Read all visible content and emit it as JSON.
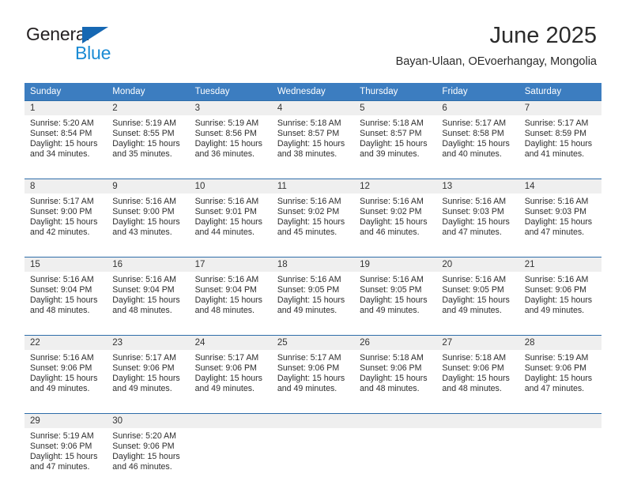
{
  "brand": {
    "name_part1": "General",
    "name_part2": "Blue",
    "logo_icon": "triangle-logo-icon",
    "color_dark": "#231F20",
    "color_blue": "#1A8BD4",
    "color_triangle": "#1668B3"
  },
  "header": {
    "title": "June 2025",
    "subtitle": "Bayan-Ulaan, OEvoerhangay, Mongolia"
  },
  "theme": {
    "header_row_bg": "#3C7DC0",
    "row_border": "#2E6DA9",
    "daynum_bg": "#EFEFEF",
    "text": "#2D2D2D"
  },
  "weekday_headers": [
    "Sunday",
    "Monday",
    "Tuesday",
    "Wednesday",
    "Thursday",
    "Friday",
    "Saturday"
  ],
  "weeks": [
    {
      "days": [
        {
          "num": "1",
          "sunrise": "Sunrise: 5:20 AM",
          "sunset": "Sunset: 8:54 PM",
          "daylight": "Daylight: 15 hours and 34 minutes."
        },
        {
          "num": "2",
          "sunrise": "Sunrise: 5:19 AM",
          "sunset": "Sunset: 8:55 PM",
          "daylight": "Daylight: 15 hours and 35 minutes."
        },
        {
          "num": "3",
          "sunrise": "Sunrise: 5:19 AM",
          "sunset": "Sunset: 8:56 PM",
          "daylight": "Daylight: 15 hours and 36 minutes."
        },
        {
          "num": "4",
          "sunrise": "Sunrise: 5:18 AM",
          "sunset": "Sunset: 8:57 PM",
          "daylight": "Daylight: 15 hours and 38 minutes."
        },
        {
          "num": "5",
          "sunrise": "Sunrise: 5:18 AM",
          "sunset": "Sunset: 8:57 PM",
          "daylight": "Daylight: 15 hours and 39 minutes."
        },
        {
          "num": "6",
          "sunrise": "Sunrise: 5:17 AM",
          "sunset": "Sunset: 8:58 PM",
          "daylight": "Daylight: 15 hours and 40 minutes."
        },
        {
          "num": "7",
          "sunrise": "Sunrise: 5:17 AM",
          "sunset": "Sunset: 8:59 PM",
          "daylight": "Daylight: 15 hours and 41 minutes."
        }
      ]
    },
    {
      "days": [
        {
          "num": "8",
          "sunrise": "Sunrise: 5:17 AM",
          "sunset": "Sunset: 9:00 PM",
          "daylight": "Daylight: 15 hours and 42 minutes."
        },
        {
          "num": "9",
          "sunrise": "Sunrise: 5:16 AM",
          "sunset": "Sunset: 9:00 PM",
          "daylight": "Daylight: 15 hours and 43 minutes."
        },
        {
          "num": "10",
          "sunrise": "Sunrise: 5:16 AM",
          "sunset": "Sunset: 9:01 PM",
          "daylight": "Daylight: 15 hours and 44 minutes."
        },
        {
          "num": "11",
          "sunrise": "Sunrise: 5:16 AM",
          "sunset": "Sunset: 9:02 PM",
          "daylight": "Daylight: 15 hours and 45 minutes."
        },
        {
          "num": "12",
          "sunrise": "Sunrise: 5:16 AM",
          "sunset": "Sunset: 9:02 PM",
          "daylight": "Daylight: 15 hours and 46 minutes."
        },
        {
          "num": "13",
          "sunrise": "Sunrise: 5:16 AM",
          "sunset": "Sunset: 9:03 PM",
          "daylight": "Daylight: 15 hours and 47 minutes."
        },
        {
          "num": "14",
          "sunrise": "Sunrise: 5:16 AM",
          "sunset": "Sunset: 9:03 PM",
          "daylight": "Daylight: 15 hours and 47 minutes."
        }
      ]
    },
    {
      "days": [
        {
          "num": "15",
          "sunrise": "Sunrise: 5:16 AM",
          "sunset": "Sunset: 9:04 PM",
          "daylight": "Daylight: 15 hours and 48 minutes."
        },
        {
          "num": "16",
          "sunrise": "Sunrise: 5:16 AM",
          "sunset": "Sunset: 9:04 PM",
          "daylight": "Daylight: 15 hours and 48 minutes."
        },
        {
          "num": "17",
          "sunrise": "Sunrise: 5:16 AM",
          "sunset": "Sunset: 9:04 PM",
          "daylight": "Daylight: 15 hours and 48 minutes."
        },
        {
          "num": "18",
          "sunrise": "Sunrise: 5:16 AM",
          "sunset": "Sunset: 9:05 PM",
          "daylight": "Daylight: 15 hours and 49 minutes."
        },
        {
          "num": "19",
          "sunrise": "Sunrise: 5:16 AM",
          "sunset": "Sunset: 9:05 PM",
          "daylight": "Daylight: 15 hours and 49 minutes."
        },
        {
          "num": "20",
          "sunrise": "Sunrise: 5:16 AM",
          "sunset": "Sunset: 9:05 PM",
          "daylight": "Daylight: 15 hours and 49 minutes."
        },
        {
          "num": "21",
          "sunrise": "Sunrise: 5:16 AM",
          "sunset": "Sunset: 9:06 PM",
          "daylight": "Daylight: 15 hours and 49 minutes."
        }
      ]
    },
    {
      "days": [
        {
          "num": "22",
          "sunrise": "Sunrise: 5:16 AM",
          "sunset": "Sunset: 9:06 PM",
          "daylight": "Daylight: 15 hours and 49 minutes."
        },
        {
          "num": "23",
          "sunrise": "Sunrise: 5:17 AM",
          "sunset": "Sunset: 9:06 PM",
          "daylight": "Daylight: 15 hours and 49 minutes."
        },
        {
          "num": "24",
          "sunrise": "Sunrise: 5:17 AM",
          "sunset": "Sunset: 9:06 PM",
          "daylight": "Daylight: 15 hours and 49 minutes."
        },
        {
          "num": "25",
          "sunrise": "Sunrise: 5:17 AM",
          "sunset": "Sunset: 9:06 PM",
          "daylight": "Daylight: 15 hours and 49 minutes."
        },
        {
          "num": "26",
          "sunrise": "Sunrise: 5:18 AM",
          "sunset": "Sunset: 9:06 PM",
          "daylight": "Daylight: 15 hours and 48 minutes."
        },
        {
          "num": "27",
          "sunrise": "Sunrise: 5:18 AM",
          "sunset": "Sunset: 9:06 PM",
          "daylight": "Daylight: 15 hours and 48 minutes."
        },
        {
          "num": "28",
          "sunrise": "Sunrise: 5:19 AM",
          "sunset": "Sunset: 9:06 PM",
          "daylight": "Daylight: 15 hours and 47 minutes."
        }
      ]
    },
    {
      "days": [
        {
          "num": "29",
          "sunrise": "Sunrise: 5:19 AM",
          "sunset": "Sunset: 9:06 PM",
          "daylight": "Daylight: 15 hours and 47 minutes."
        },
        {
          "num": "30",
          "sunrise": "Sunrise: 5:20 AM",
          "sunset": "Sunset: 9:06 PM",
          "daylight": "Daylight: 15 hours and 46 minutes."
        },
        {
          "num": "",
          "sunrise": "",
          "sunset": "",
          "daylight": ""
        },
        {
          "num": "",
          "sunrise": "",
          "sunset": "",
          "daylight": ""
        },
        {
          "num": "",
          "sunrise": "",
          "sunset": "",
          "daylight": ""
        },
        {
          "num": "",
          "sunrise": "",
          "sunset": "",
          "daylight": ""
        },
        {
          "num": "",
          "sunrise": "",
          "sunset": "",
          "daylight": ""
        }
      ]
    }
  ]
}
